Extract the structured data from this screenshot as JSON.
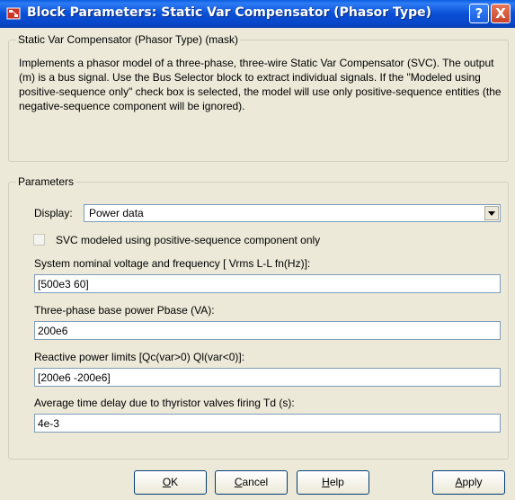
{
  "window": {
    "title": "Block Parameters: Static Var Compensator (Phasor Type)",
    "help_symbol": "?",
    "close_symbol": "X"
  },
  "mask": {
    "legend": "Static Var Compensator (Phasor Type) (mask)",
    "description": "Implements a  phasor model of a three-phase, three-wire Static Var Compensator (SVC). The output (m) is a bus signal. Use the Bus Selector block to extract individual signals. If the \"Modeled using positive-sequence only\" check box is selected, the model will use only positive-sequence entities (the negative-sequence component will be ignored)."
  },
  "parameters": {
    "legend": "Parameters",
    "display_label": "Display:",
    "display_value": "Power data",
    "checkbox_label": "SVC modeled using  positive-sequence component only",
    "checkbox_checked": false,
    "fields": [
      {
        "label": "System nominal voltage and frequency [ Vrms L-L  fn(Hz)]:",
        "value": "[500e3  60]"
      },
      {
        "label": "Three-phase base power Pbase (VA):",
        "value": "200e6"
      },
      {
        "label": "Reactive power limits [Qc(var>0)  Ql(var<0)]:",
        "value": "[200e6  -200e6]"
      },
      {
        "label": "Average time delay due to thyristor valves firing Td (s):",
        "value": "4e-3"
      }
    ]
  },
  "buttons": {
    "ok": {
      "accel": "O",
      "rest": "K"
    },
    "cancel": {
      "accel": "C",
      "rest": "ancel"
    },
    "help": {
      "accel": "H",
      "rest": "elp"
    },
    "apply": {
      "accel": "A",
      "rest": "pply"
    }
  }
}
